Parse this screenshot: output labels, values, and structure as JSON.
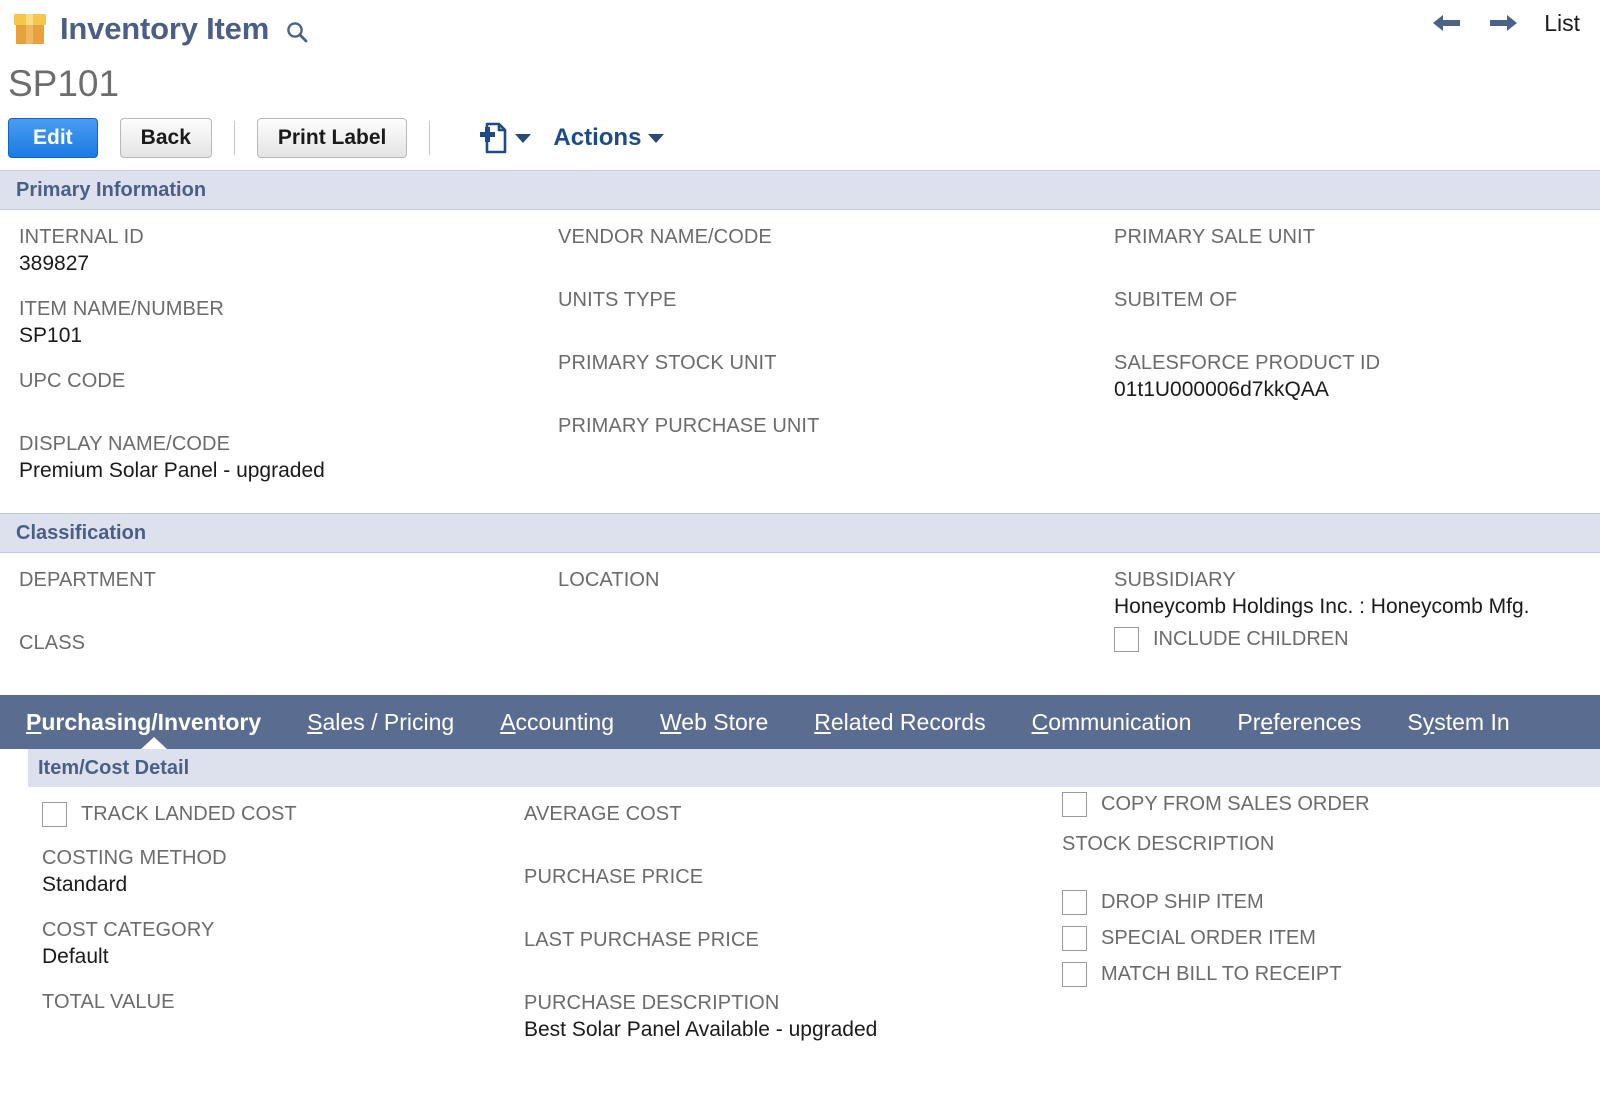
{
  "header": {
    "record_type": "Inventory Item",
    "logo_icon": "box-icon",
    "search_icon": "search-icon",
    "prev_icon": "arrow-left-icon",
    "next_icon": "arrow-right-icon",
    "list_label": "List",
    "record_title": "SP101"
  },
  "toolbar": {
    "edit_label": "Edit",
    "back_label": "Back",
    "print_label": "Print Label",
    "new_doc_icon": "new-document-icon",
    "new_doc_caret_icon": "chevron-down-icon",
    "actions_label": "Actions",
    "actions_caret_icon": "chevron-down-icon"
  },
  "primary_information": {
    "title": "Primary Information",
    "col1": [
      {
        "label": "INTERNAL ID",
        "value": "389827"
      },
      {
        "label": "ITEM NAME/NUMBER",
        "value": "SP101"
      },
      {
        "label": "UPC CODE",
        "value": ""
      },
      {
        "label": "DISPLAY NAME/CODE",
        "value": "Premium Solar Panel - upgraded"
      }
    ],
    "col2": [
      {
        "label": "VENDOR NAME/CODE",
        "value": ""
      },
      {
        "label": "UNITS TYPE",
        "value": ""
      },
      {
        "label": "PRIMARY STOCK UNIT",
        "value": ""
      },
      {
        "label": "PRIMARY PURCHASE UNIT",
        "value": ""
      }
    ],
    "col3": [
      {
        "label": "PRIMARY SALE UNIT",
        "value": ""
      },
      {
        "label": "SUBITEM OF",
        "value": ""
      },
      {
        "label": "SALESFORCE PRODUCT ID",
        "value": "01t1U000006d7kkQAA"
      }
    ]
  },
  "classification": {
    "title": "Classification",
    "col1": [
      {
        "label": "DEPARTMENT",
        "value": ""
      },
      {
        "label": "CLASS",
        "value": ""
      }
    ],
    "col2": [
      {
        "label": "LOCATION",
        "value": ""
      }
    ],
    "col3": [
      {
        "label": "SUBSIDIARY",
        "value": "Honeycomb Holdings Inc. : Honeycomb Mfg."
      }
    ],
    "include_children": {
      "label": "INCLUDE CHILDREN",
      "checked": false
    }
  },
  "tabs": [
    {
      "label": "Purchasing/Inventory",
      "accel": "P",
      "active": true
    },
    {
      "label": "Sales / Pricing",
      "accel": "S",
      "active": false
    },
    {
      "label": "Accounting",
      "accel": "A",
      "active": false
    },
    {
      "label": "Web Store",
      "accel": "W",
      "active": false
    },
    {
      "label": "Related Records",
      "accel": "R",
      "active": false
    },
    {
      "label": "Communication",
      "accel": "C",
      "active": false
    },
    {
      "label": "Preferences",
      "accel": "e",
      "active": false
    },
    {
      "label": "System In",
      "accel": "y",
      "active": false
    }
  ],
  "item_cost_detail": {
    "title": "Item/Cost Detail",
    "track_landed_cost": {
      "label": "TRACK LANDED COST",
      "checked": false
    },
    "col1": [
      {
        "label": "COSTING METHOD",
        "value": "Standard"
      },
      {
        "label": "COST CATEGORY",
        "value": "Default"
      },
      {
        "label": "TOTAL VALUE",
        "value": ""
      }
    ],
    "col2": [
      {
        "label": "AVERAGE COST",
        "value": ""
      },
      {
        "label": "PURCHASE PRICE",
        "value": ""
      },
      {
        "label": "LAST PURCHASE PRICE",
        "value": ""
      },
      {
        "label": "PURCHASE DESCRIPTION",
        "value": "Best Solar Panel Available - upgraded"
      }
    ],
    "col3_checkboxes_top": [
      {
        "label": "COPY FROM SALES ORDER",
        "checked": false
      }
    ],
    "col3_field": {
      "label": "STOCK DESCRIPTION",
      "value": ""
    },
    "col3_checkboxes_bottom": [
      {
        "label": "DROP SHIP ITEM",
        "checked": false
      },
      {
        "label": "SPECIAL ORDER ITEM",
        "checked": false
      },
      {
        "label": "MATCH BILL TO RECEIPT",
        "checked": false
      }
    ]
  },
  "colors": {
    "accent_blue": "#1b7ae4",
    "header_text": "#4b5f86",
    "tabbar": "#5a6d91",
    "band": "#dce1ed",
    "logo_orange": "#e9a13b"
  }
}
